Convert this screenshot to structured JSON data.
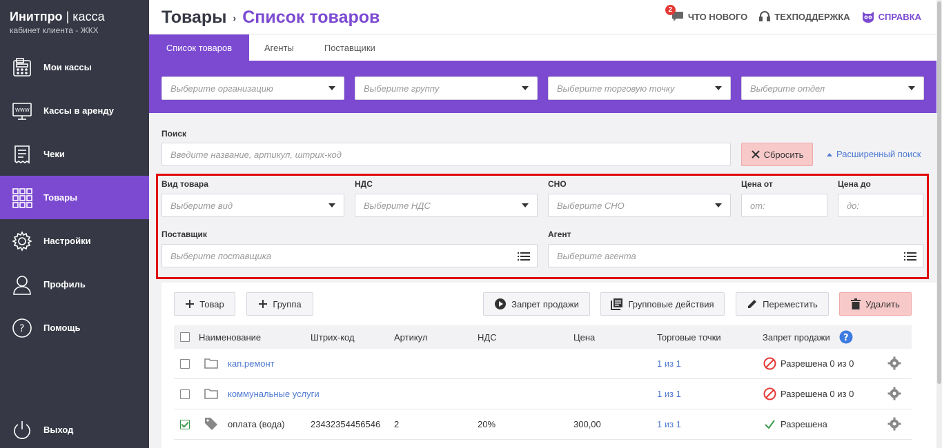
{
  "brand": {
    "title_bold": "Инитпро",
    "title_sep": "|",
    "title_light": "касса",
    "subtitle": "кабинет клиента - ЖКХ"
  },
  "nav": {
    "items": [
      {
        "label": "Мои кассы",
        "icon": "cash-register-icon"
      },
      {
        "label": "Кассы в аренду",
        "icon": "monitor-www-icon"
      },
      {
        "label": "Чеки",
        "icon": "receipt-icon"
      },
      {
        "label": "Товары",
        "icon": "grid-icon",
        "active": true
      },
      {
        "label": "Настройки",
        "icon": "gear-icon"
      },
      {
        "label": "Профиль",
        "icon": "user-icon"
      },
      {
        "label": "Помощь",
        "icon": "question-icon"
      }
    ],
    "logout": {
      "label": "Выход",
      "icon": "power-icon"
    }
  },
  "header": {
    "crumb_root": "Товары",
    "crumb_sep": "›",
    "crumb_current": "Список товаров",
    "whats_new": {
      "label": "ЧТО НОВОГО",
      "badge": "2"
    },
    "support": {
      "label": "ТЕХПОДДЕРЖКА"
    },
    "help": {
      "label": "СПРАВКА"
    }
  },
  "tabs": [
    {
      "label": "Список товаров",
      "active": true
    },
    {
      "label": "Агенты"
    },
    {
      "label": "Поставщики"
    }
  ],
  "filters": {
    "organization": "Выберите организацию",
    "group": "Выберите группу",
    "point": "Выберите торговую точку",
    "department": "Выберите отдел"
  },
  "search": {
    "label": "Поиск",
    "placeholder": "Введите название, артикул, штрих-код",
    "reset_label": "Сбросить",
    "advanced_label": "Расширенный поиск"
  },
  "advanced": {
    "type_label": "Вид товара",
    "type_placeholder": "Выберите вид",
    "vat_label": "НДС",
    "vat_placeholder": "Выберите НДС",
    "sno_label": "СНО",
    "sno_placeholder": "Выберите СНО",
    "price_from_label": "Цена от",
    "price_from_placeholder": "от:",
    "price_to_label": "Цена до",
    "price_to_placeholder": "до:",
    "supplier_label": "Поставщик",
    "supplier_placeholder": "Выберите поставщика",
    "agent_label": "Агент",
    "agent_placeholder": "Выберите агента"
  },
  "toolbar": {
    "add_product": "Товар",
    "add_group": "Группа",
    "ban_sale": "Запрет продажи",
    "group_actions": "Групповые действия",
    "move": "Переместить",
    "delete": "Удалить"
  },
  "table": {
    "columns": [
      "Наименование",
      "Штрих-код",
      "Артикул",
      "НДС",
      "Цена",
      "Торговые точки",
      "Запрет продажи"
    ],
    "rows": [
      {
        "kind": "folder",
        "name": "кап.ремонт",
        "barcode": "",
        "article": "",
        "vat": "",
        "price": "",
        "points": "1 из 1",
        "status": "Разрешена 0 из 0",
        "status_kind": "banned",
        "checked": false
      },
      {
        "kind": "folder",
        "name": "коммунальные услуги",
        "barcode": "",
        "article": "",
        "vat": "",
        "price": "",
        "points": "1 из 1",
        "status": "Разрешена 0 из 0",
        "status_kind": "banned",
        "checked": false
      },
      {
        "kind": "product",
        "name": "оплата (вода)",
        "barcode": "23432354456546",
        "article": "2",
        "vat": "20%",
        "price": "300,00",
        "points": "1 из 1",
        "status": "Разрешена",
        "status_kind": "allowed",
        "checked": true
      }
    ]
  },
  "colors": {
    "sidebar": "#363845",
    "accent": "#7c4ad1",
    "danger_bg": "#f8c9c9",
    "link": "#4f7ad1",
    "highlight": "#e00000"
  }
}
